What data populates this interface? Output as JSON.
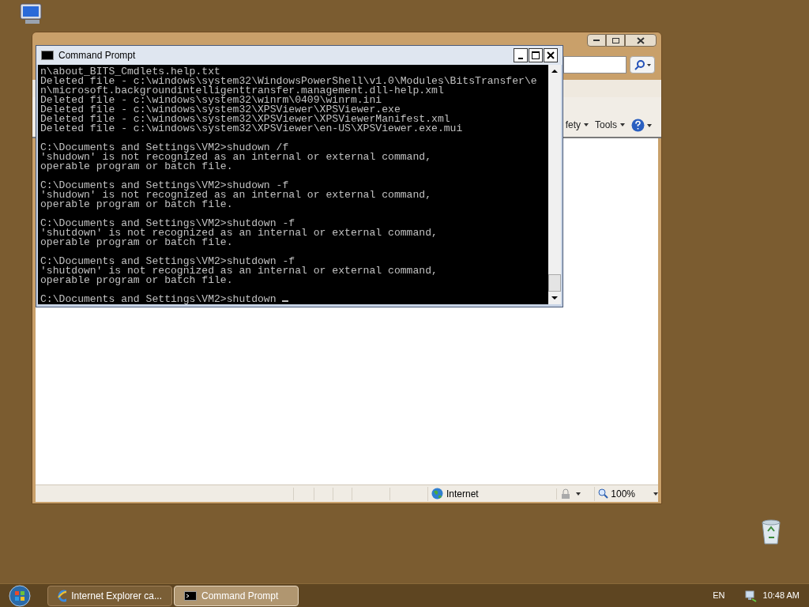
{
  "ie_window": {
    "toolbar": [
      {
        "label": "fety"
      },
      {
        "label": "Tools"
      }
    ],
    "status_bar": {
      "zone": "Internet",
      "zoom": "100%"
    }
  },
  "console": {
    "title": "Command Prompt",
    "blocks": [
      [
        "n\\about_BITS_Cmdlets.help.txt",
        "Deleted file - c:\\windows\\system32\\WindowsPowerShell\\v1.0\\Modules\\BitsTransfer\\e",
        "n\\microsoft.backgroundintelligenttransfer.management.dll-help.xml",
        "Deleted file - c:\\windows\\system32\\winrm\\0409\\winrm.ini",
        "Deleted file - c:\\windows\\system32\\XPSViewer\\XPSViewer.exe",
        "Deleted file - c:\\windows\\system32\\XPSViewer\\XPSViewerManifest.xml",
        "Deleted file - c:\\windows\\system32\\XPSViewer\\en-US\\XPSViewer.exe.mui"
      ],
      [
        "C:\\Documents and Settings\\VM2>shudown /f",
        "'shudown' is not recognized as an internal or external command,",
        "operable program or batch file."
      ],
      [
        "C:\\Documents and Settings\\VM2>shudown -f",
        "'shudown' is not recognized as an internal or external command,",
        "operable program or batch file."
      ],
      [
        "C:\\Documents and Settings\\VM2>shutdown -f",
        "'shutdown' is not recognized as an internal or external command,",
        "operable program or batch file."
      ],
      [
        "C:\\Documents and Settings\\VM2>shutdown -f",
        "'shutdown' is not recognized as an internal or external command,",
        "operable program or batch file."
      ],
      [
        "C:\\Documents and Settings\\VM2>shutdown "
      ]
    ]
  },
  "taskbar": {
    "buttons": [
      {
        "label": "Internet Explorer ca...",
        "kind": "ie",
        "selected": false
      },
      {
        "label": "Command Prompt",
        "kind": "cmd",
        "selected": true
      }
    ],
    "language": "EN",
    "clock": "10:48 AM"
  }
}
